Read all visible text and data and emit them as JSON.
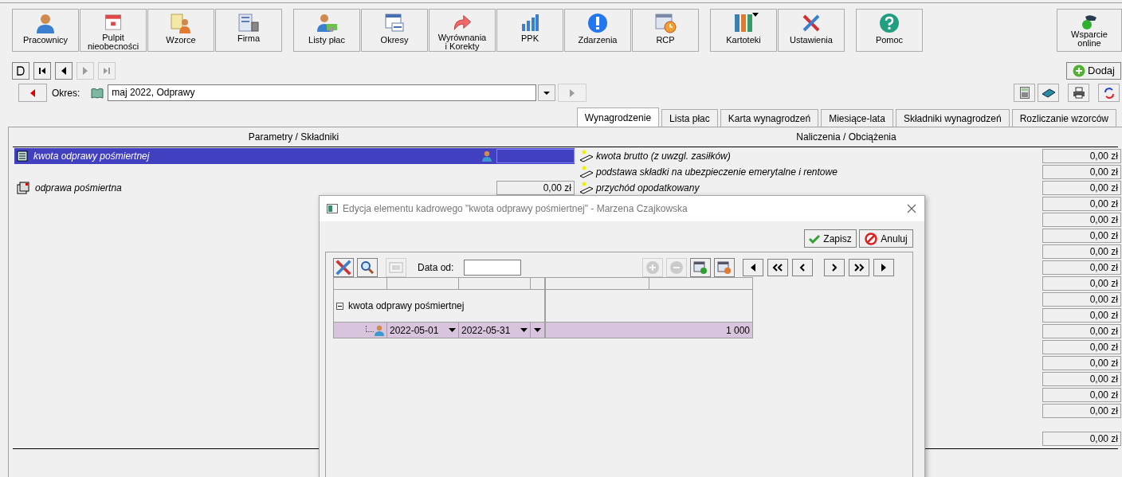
{
  "toolbar_groups": [
    [
      {
        "lines": [
          "Pracownicy"
        ],
        "kind": "person"
      },
      {
        "lines": [
          "Pulpit",
          "nieobecności"
        ],
        "kind": "calendar"
      },
      {
        "lines": [
          "Wzorce"
        ],
        "kind": "templates"
      },
      {
        "lines": [
          "Firma"
        ],
        "kind": "building"
      }
    ],
    [
      {
        "lines": [
          "Listy płac"
        ],
        "kind": "payroll"
      },
      {
        "lines": [
          "Okresy"
        ],
        "kind": "periods"
      },
      {
        "lines": [
          "Wyrównania",
          "i Korekty"
        ],
        "kind": "arrow"
      },
      {
        "lines": [
          "PPK"
        ],
        "kind": "chart"
      },
      {
        "lines": [
          "Zdarzenia"
        ],
        "kind": "info"
      },
      {
        "lines": [
          "RCP"
        ],
        "kind": "clock"
      }
    ],
    [
      {
        "lines": [
          "Kartoteki"
        ],
        "kind": "binders",
        "menu": true
      },
      {
        "lines": [
          "Ustawienia"
        ],
        "kind": "tools"
      }
    ],
    [
      {
        "lines": [
          "Pomoc"
        ],
        "kind": "help"
      }
    ]
  ],
  "support_button": {
    "lines": [
      "Wsparcie",
      "online"
    ]
  },
  "nav_buttons": [
    {
      "kind": "new",
      "disabled": false
    },
    {
      "kind": "first",
      "disabled": false
    },
    {
      "kind": "prev",
      "disabled": false
    },
    {
      "kind": "next",
      "disabled": true
    },
    {
      "kind": "last",
      "disabled": true
    }
  ],
  "add_button": "Dodaj",
  "period": {
    "label": "Okres:",
    "value": "maj 2022, Odprawy",
    "next_disabled": true
  },
  "tabs": [
    {
      "label": "Wynagrodzenie",
      "selected": true
    },
    {
      "label": "Lista płac",
      "selected": false
    },
    {
      "label": "Karta wynagrodzeń",
      "selected": false
    },
    {
      "label": "Miesiące-lata",
      "selected": false
    },
    {
      "label": "Składniki wynagrodzeń",
      "selected": false
    },
    {
      "label": "Rozliczanie wzorców",
      "selected": false
    }
  ],
  "table": {
    "left_header": "Parametry / Składniki",
    "right_header": "Naliczenia / Obciążenia",
    "left_rows": [
      {
        "kind": "item",
        "label": "kwota odprawy pośmiertnej",
        "selected": true
      },
      {
        "kind": "empty",
        "selected": false
      },
      {
        "kind": "group",
        "label": "odprawa pośmiertna",
        "value": "0,00 zł",
        "selected": false
      }
    ],
    "right_rows": [
      {
        "label": "kwota brutto (z uwzgl. zasiłków)",
        "value": "0,00 zł"
      },
      {
        "label": "podstawa składki na ubezpieczenie emerytalne i rentowe",
        "value": "0,00 zł"
      },
      {
        "label": "przychód opodatkowany",
        "value": "0,00 zł"
      },
      {
        "value": "0,00 zł"
      },
      {
        "value": "0,00 zł"
      },
      {
        "value": "0,00 zł"
      },
      {
        "value": "0,00 zł"
      },
      {
        "value": "0,00 zł"
      },
      {
        "value": "0,00 zł"
      },
      {
        "value": "0,00 zł"
      },
      {
        "value": "0,00 zł"
      },
      {
        "value": "0,00 zł"
      },
      {
        "value": "0,00 zł"
      },
      {
        "value": "0,00 zł"
      },
      {
        "value": "0,00 zł"
      },
      {
        "value": "0,00 zł"
      },
      {
        "value": "0,00 zł"
      }
    ],
    "total": "0,00 zł"
  },
  "dialog": {
    "title": "Edycja elementu kadrowego \"kwota odprawy pośmiertnej\" - Marzena Czajkowska",
    "save": "Zapisz",
    "cancel": "Anuluj",
    "date_label": "Data od:",
    "tools": [
      {
        "kind": "tools",
        "disabled": false
      },
      {
        "kind": "search",
        "disabled": false
      },
      {
        "kind": "number",
        "disabled": true
      }
    ],
    "row_tools": [
      {
        "kind": "plus",
        "disabled": true
      },
      {
        "kind": "minus",
        "disabled": true
      },
      {
        "kind": "add-record",
        "disabled": false
      },
      {
        "kind": "remove-record",
        "disabled": false
      }
    ],
    "tree": {
      "label": "kwota odprawy pośmiertnej",
      "expanded": true,
      "children": [
        {
          "from": "2022-05-01",
          "to": "2022-05-31",
          "value": "1 000",
          "selected": true
        }
      ]
    }
  }
}
